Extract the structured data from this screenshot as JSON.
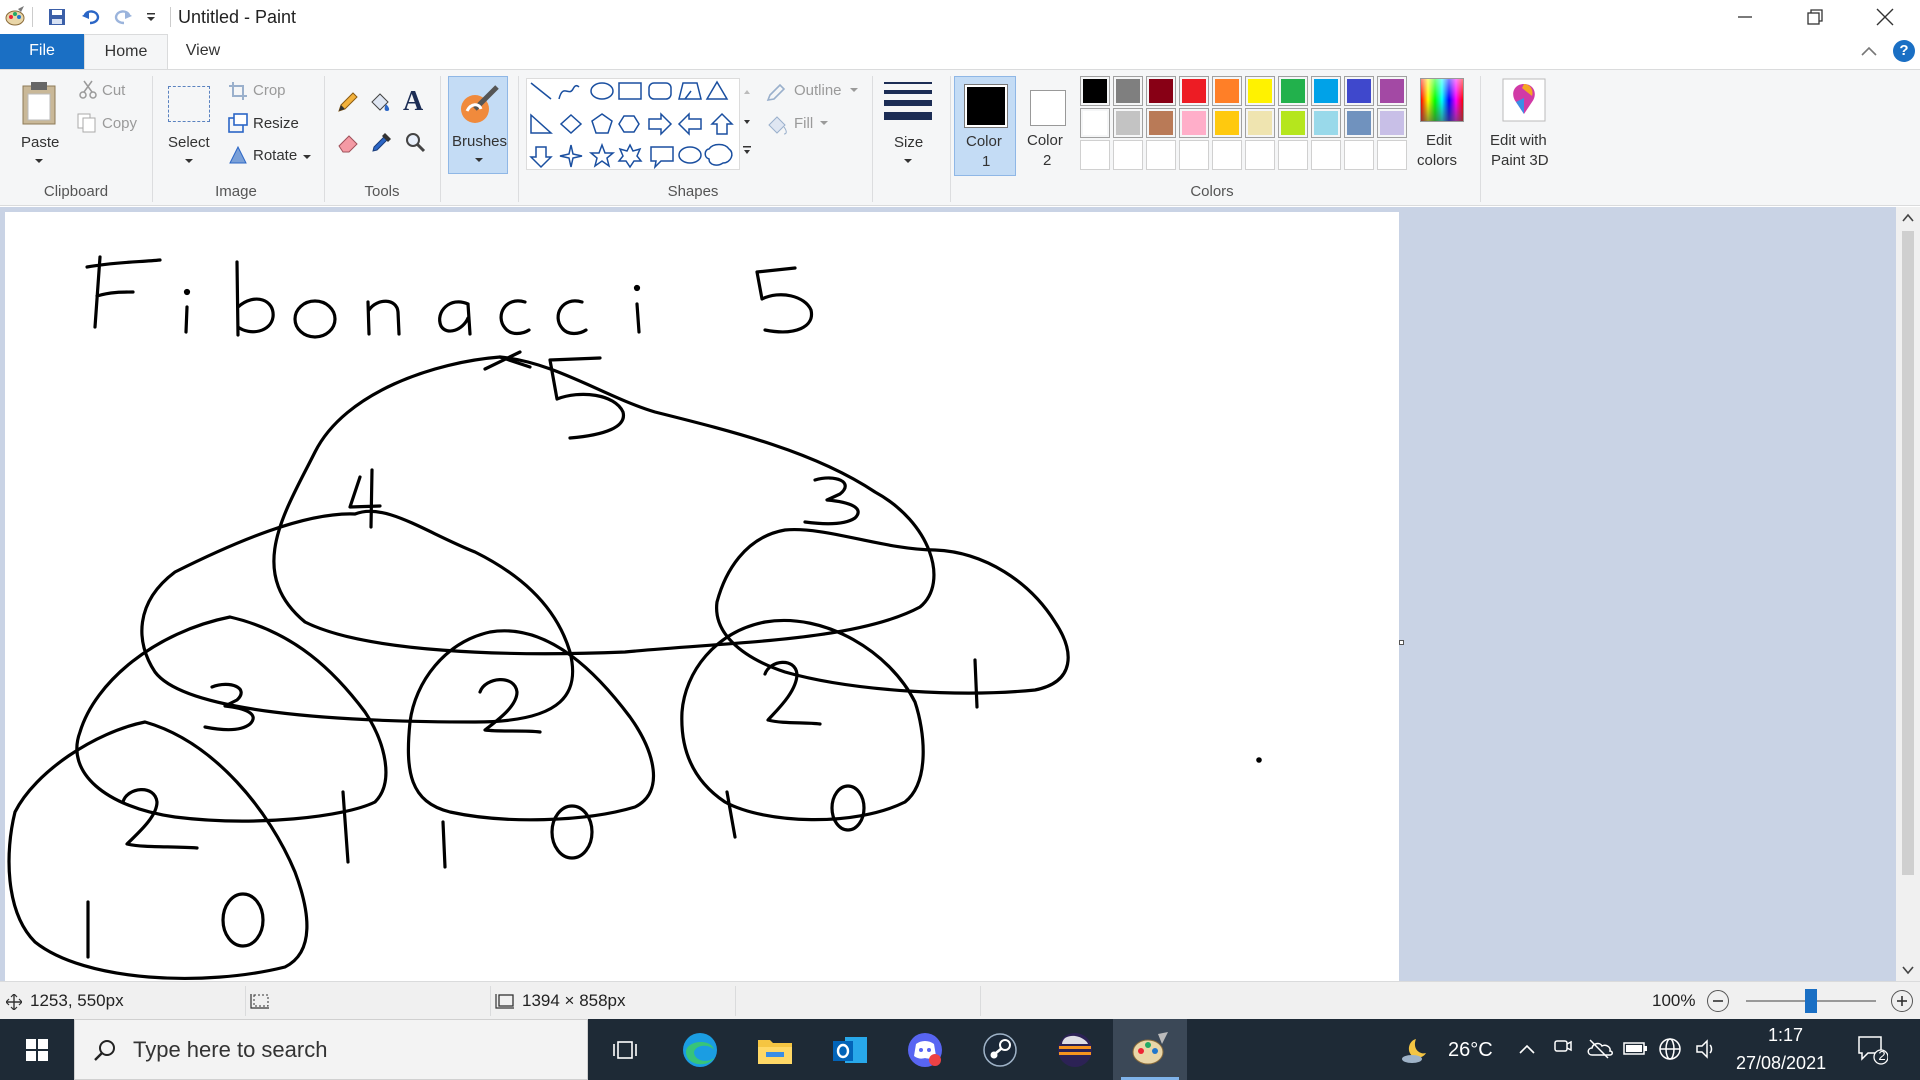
{
  "window": {
    "title": "Untitled - Paint"
  },
  "tabs": {
    "file": "File",
    "home": "Home",
    "view": "View"
  },
  "ribbon": {
    "clipboard": {
      "paste": "Paste",
      "cut": "Cut",
      "copy": "Copy",
      "label": "Clipboard"
    },
    "image": {
      "select": "Select",
      "crop": "Crop",
      "resize": "Resize",
      "rotate": "Rotate",
      "label": "Image"
    },
    "tools": {
      "label": "Tools"
    },
    "brushes": {
      "label": "Brushes"
    },
    "shapes": {
      "outline": "Outline",
      "fill": "Fill",
      "label": "Shapes"
    },
    "size": {
      "label": "Size"
    },
    "color1": {
      "line1": "Color",
      "line2": "1",
      "value": "#000000"
    },
    "color2": {
      "line1": "Color",
      "line2": "2",
      "value": "#ffffff"
    },
    "colors": {
      "label": "Colors"
    },
    "edit_colors": {
      "line1": "Edit",
      "line2": "colors"
    },
    "paint3d": {
      "line1": "Edit with",
      "line2": "Paint 3D"
    },
    "palette_row1": [
      "#000000",
      "#7f7f7f",
      "#880015",
      "#ed1c24",
      "#ff7f27",
      "#fff200",
      "#22b14c",
      "#00a2e8",
      "#3f48cc",
      "#a349a4"
    ],
    "palette_row2": [
      "#ffffff",
      "#c3c3c3",
      "#b97a57",
      "#ffaec9",
      "#ffc90e",
      "#efe4b0",
      "#b5e61d",
      "#99d9ea",
      "#7092be",
      "#c8bfe7"
    ],
    "palette_row3": [
      "#ffffff",
      "#ffffff",
      "#ffffff",
      "#ffffff",
      "#ffffff",
      "#ffffff",
      "#ffffff",
      "#ffffff",
      "#ffffff",
      "#ffffff"
    ]
  },
  "drawing": {
    "title": "Fibonacci 5",
    "nodes": [
      "5",
      "4",
      "3",
      "3",
      "2",
      "2",
      "1",
      "2",
      "1",
      "1",
      "0",
      "1",
      "0",
      "1",
      "0"
    ]
  },
  "statusbar": {
    "cursor_pos": "1253, 550px",
    "image_size": "1394 × 858px",
    "zoom": "100%",
    "zoom_value": 100
  },
  "taskbar": {
    "search_placeholder": "Type here to search",
    "weather": "26°C",
    "time": "1:17",
    "date": "27/08/2021",
    "notification_count": "2"
  }
}
